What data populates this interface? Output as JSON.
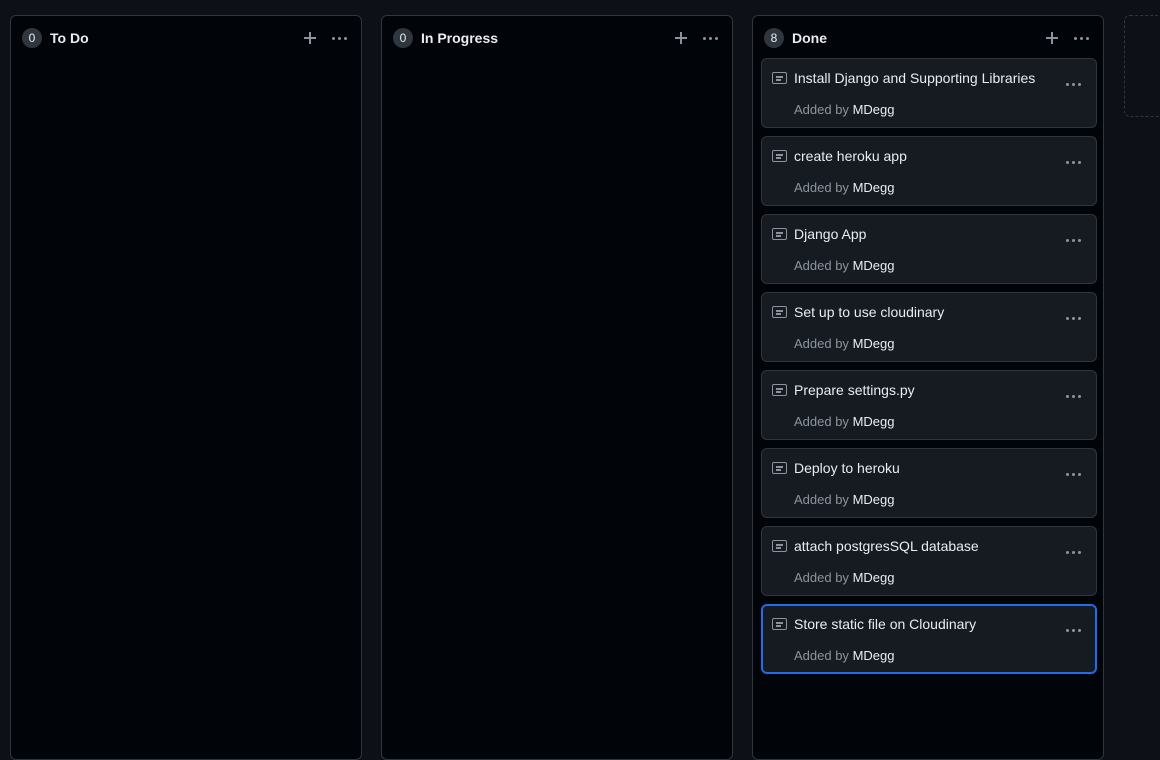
{
  "columns": [
    {
      "title": "To Do",
      "count": "0",
      "cards": []
    },
    {
      "title": "In Progress",
      "count": "0",
      "cards": []
    },
    {
      "title": "Done",
      "count": "8",
      "cards": [
        {
          "title": "Install Django and Supporting Libraries",
          "added_by_label": "Added by",
          "author": "MDegg"
        },
        {
          "title": "create heroku app",
          "added_by_label": "Added by",
          "author": "MDegg"
        },
        {
          "title": "Django App",
          "added_by_label": "Added by",
          "author": "MDegg"
        },
        {
          "title": "Set up to use cloudinary",
          "added_by_label": "Added by",
          "author": "MDegg"
        },
        {
          "title": "Prepare settings.py",
          "added_by_label": "Added by",
          "author": "MDegg"
        },
        {
          "title": "Deploy to heroku",
          "added_by_label": "Added by",
          "author": "MDegg"
        },
        {
          "title": "attach postgresSQL database",
          "added_by_label": "Added by",
          "author": "MDegg"
        },
        {
          "title": "Store static file on Cloudinary",
          "added_by_label": "Added by",
          "author": "MDegg"
        }
      ]
    }
  ],
  "focused_card": {
    "column": 2,
    "index": 7
  },
  "icons": {
    "add": "plus-icon",
    "menu": "kebab-menu-icon",
    "card": "note-icon"
  },
  "colors": {
    "accent": "#1f6feb",
    "background": "#0d1117",
    "column_bg": "#010409",
    "card_bg": "#161b22"
  }
}
